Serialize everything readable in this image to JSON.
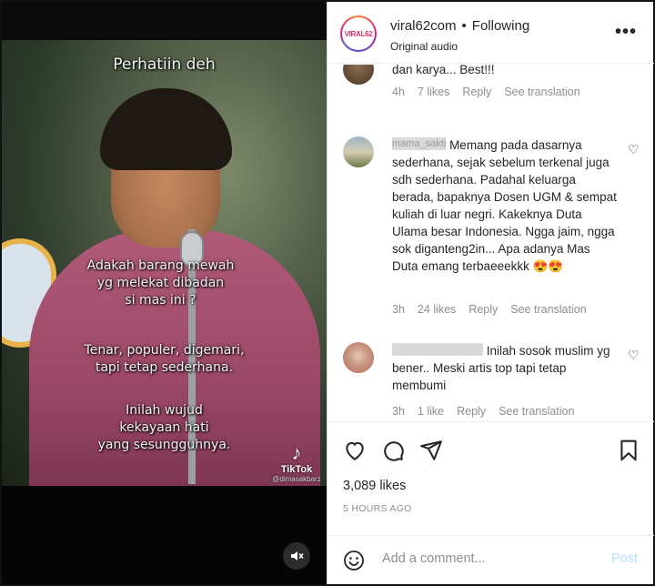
{
  "video": {
    "overlay_title": "Perhatiin deh",
    "overlay_lines_1": [
      "Adakah barang mewah",
      "yg melekat dibadan",
      "si mas ini ?"
    ],
    "overlay_lines_2": [
      "Tenar, populer, digemari,",
      "tapi tetap sederhana."
    ],
    "overlay_lines_3": [
      "Inilah wujud",
      "kekayaan hati",
      "yang sesungguhnya."
    ],
    "tiktok_label": "TikTok",
    "tiktok_handle": "@dimasakbarz",
    "mute_icon": "speaker-muted-icon"
  },
  "header": {
    "avatar_text": "VIRAL62",
    "username": "viral62com",
    "separator": "•",
    "follow_status": "Following",
    "audio": "Original audio",
    "more": "•••"
  },
  "comments": [
    {
      "text": "dan karya... Best!!!",
      "time": "4h",
      "likes": "7 likes",
      "reply": "Reply",
      "translation": "See translation"
    },
    {
      "username": "mama_sakti",
      "text": "Memang pada dasarnya sederhana, sejak sebelum terkenal juga sdh sederhana. Padahal keluarga berada, bapaknya Dosen UGM & sempat kuliah di luar negri. Kakeknya Duta Ulama besar Indonesia. Ngga jaim, ngga sok diganteng2in... Apa adanya Mas Duta emang terbaeeekkk 😍😍",
      "time": "3h",
      "likes": "24 likes",
      "reply": "Reply",
      "translation": "See translation"
    },
    {
      "username": "",
      "text": "Inilah sosok muslim yg bener.. Meski artis top tapi tetap membumi",
      "time": "3h",
      "likes": "1 like",
      "reply": "Reply",
      "translation": "See translation"
    }
  ],
  "actions": {
    "likes": "3,089 likes",
    "timestamp": "5 HOURS AGO"
  },
  "composer": {
    "placeholder": "Add a comment...",
    "post": "Post"
  },
  "colors": {
    "link_blue_disabled": "#b2dffc",
    "meta_gray": "#8e8e8e",
    "text": "#262626"
  }
}
